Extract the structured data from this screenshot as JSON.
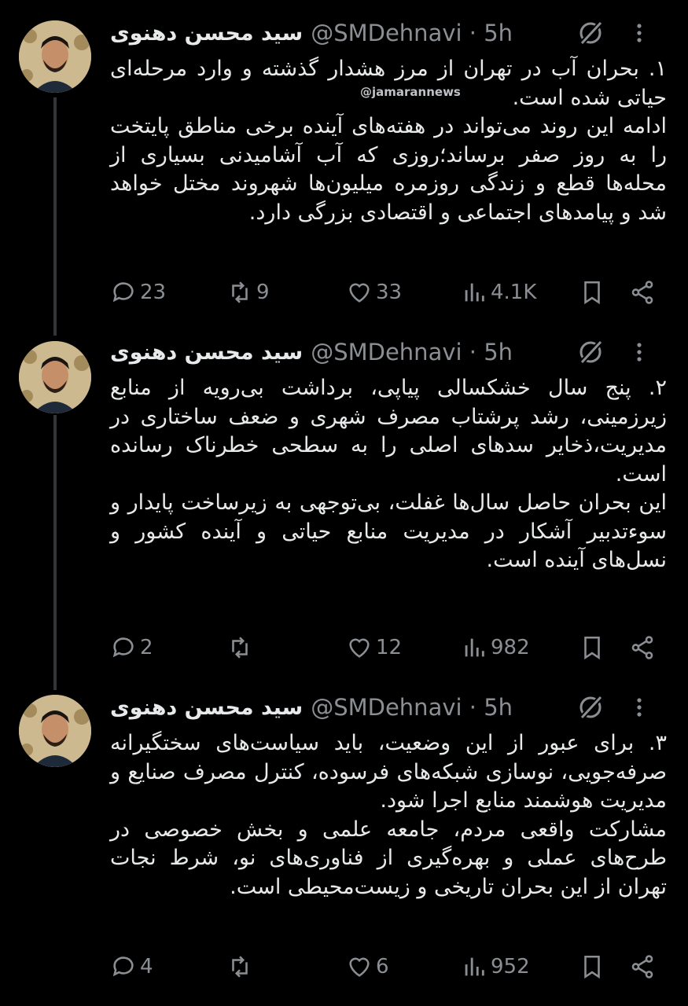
{
  "watermark": "@jamarannews",
  "tweets": [
    {
      "name": "سید محسن دهنوی",
      "handle": "@SMDehnavi · 5h",
      "lines": [
        "۱. بحران آب در تهران از مرز هشدار گذشته و وارد مرحله‌ای حیاتی شده است.",
        "ادامه این روند می‌تواند در هفته‌های آینده برخی مناطق پایتخت را به روز صفر برساند؛روزی که آب آشامیدنی بسیاری از محله‌ها قطع و زندگی روزمره میلیون‌ها شهروند مختل خواهد شد و پیامدهای اجتماعی و اقتصادی بزرگی دارد."
      ],
      "replies": "23",
      "retweets": "9",
      "likes": "33",
      "views": "4.1K"
    },
    {
      "name": "سید محسن دهنوی",
      "handle": "@SMDehnavi · 5h",
      "lines": [
        "۲. پنج سال خشکسالی پیاپی، برداشت بی‌رویه از منابع زیرزمینی، رشد پرشتاب مصرف شهری و ضعف ساختاری در مدیریت،ذخایر سدهای اصلی را به سطحی خطرناک رسانده است.",
        "این بحران حاصل سال‌ها غفلت، بی‌توجهی به زیرساخت پایدار و سوءتدبیر آشکار در مدیریت منابع حیاتی و آینده کشور و نسل‌های آینده است."
      ],
      "replies": "2",
      "retweets": "",
      "likes": "12",
      "views": "982"
    },
    {
      "name": "سید محسن دهنوی",
      "handle": "@SMDehnavi · 5h",
      "lines": [
        "۳. برای عبور از این وضعیت، باید سیاست‌های سختگیرانه صرفه‌جویی، نوسازی شبکه‌های فرسوده، کنترل مصرف صنایع و مدیریت هوشمند منابع اجرا شود.",
        "مشارکت واقعی مردم، جامعه علمی و بخش خصوصی در طرح‌های عملی و بهره‌گیری از فناوری‌های نو، شرط نجات تهران از این بحران تاریخی و زیست‌محیطی است."
      ],
      "replies": "4",
      "retweets": "",
      "likes": "6",
      "views": "952"
    }
  ],
  "icons": {
    "reply": "reply-icon",
    "retweet": "retweet-icon",
    "like": "heart-icon",
    "views": "views-icon",
    "bookmark": "bookmark-icon",
    "share": "share-icon",
    "grok": "grok-icon",
    "more": "more-icon"
  },
  "colors": {
    "background": "#000000",
    "text": "#e7e9ea",
    "muted": "#8b8f93"
  }
}
